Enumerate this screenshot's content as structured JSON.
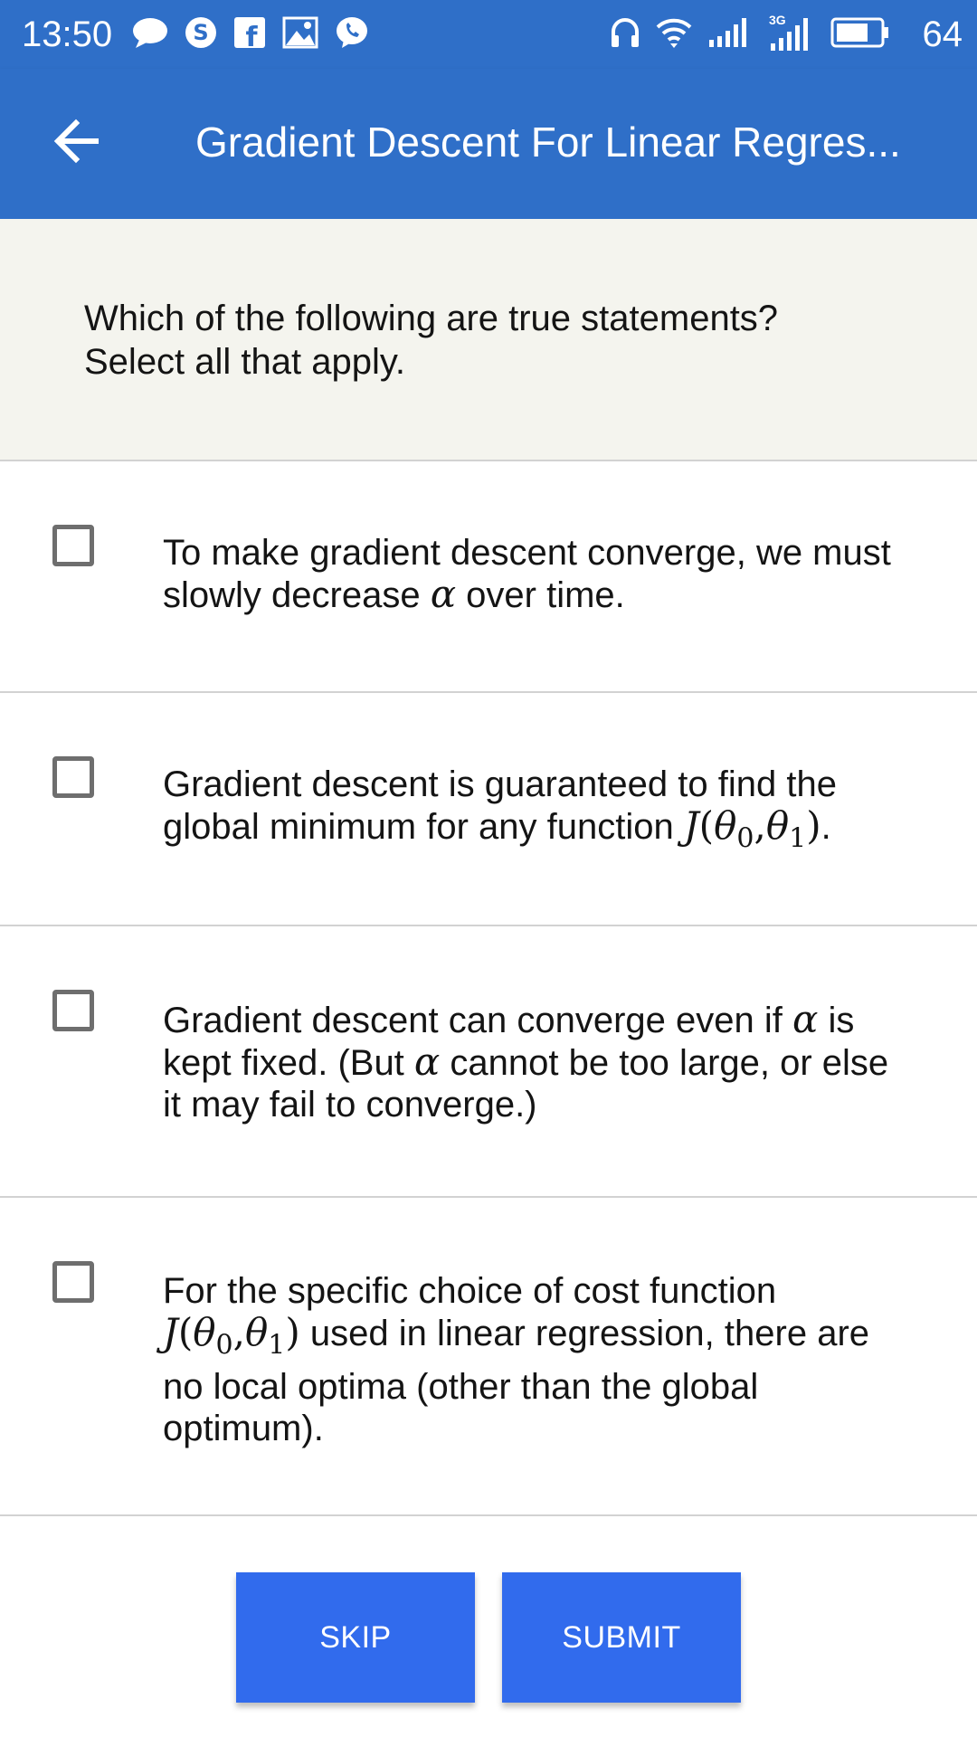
{
  "status_bar": {
    "time": "13:50",
    "battery_percent": "64",
    "left_icons": [
      "message-icon",
      "skype-icon",
      "facebook-icon",
      "gallery-icon",
      "viber-icon"
    ],
    "right_icons": [
      "headphones-icon",
      "wifi-icon",
      "signal-icon",
      "signal-3g-icon",
      "battery-icon"
    ],
    "network_label": "3G"
  },
  "app_bar": {
    "back_icon": "arrow-left-icon",
    "title": "Gradient Descent For Linear Regres..."
  },
  "question": {
    "line1": "Which of the following are true statements?",
    "line2": "Select all that apply."
  },
  "options": [
    {
      "line1": "To make gradient descent converge, we must",
      "line2_pre": "slowly decrease ",
      "line2_math": "α",
      "line2_post": " over time.",
      "checked": false
    },
    {
      "line1": "Gradient descent is guaranteed to find the",
      "line2_pre": "global minimum for any function ",
      "math_J": "J",
      "math_open": "(",
      "math_theta0": "θ",
      "math_sub0": "0",
      "math_comma": ",",
      "math_theta1": "θ",
      "math_sub1": "1",
      "math_close": ")",
      "line2_post": ".",
      "checked": false
    },
    {
      "line1_pre": "Gradient descent can converge even if ",
      "line1_math": "α",
      "line1_post": " is",
      "line2_pre": "kept fixed. (But ",
      "line2_math": "α",
      "line2_post": " cannot be too large, or else",
      "line3": "it may fail to converge.)",
      "checked": false
    },
    {
      "line1": "For the specific choice of cost function",
      "math_J": "J",
      "math_open": "(",
      "math_theta0": "θ",
      "math_sub0": "0",
      "math_comma": ",",
      "math_theta1": "θ",
      "math_sub1": "1",
      "math_close": ")",
      "line2_post": " used in linear regression, there are",
      "line3": "no local optima (other than the global",
      "line4": "optimum).",
      "checked": false
    }
  ],
  "buttons": {
    "skip_label": "SKIP",
    "submit_label": "SUBMIT"
  },
  "colors": {
    "app_bar": "#2f6fc8",
    "button": "#316bed",
    "question_bg": "#f4f4ee",
    "divider": "#d2d2d2"
  }
}
